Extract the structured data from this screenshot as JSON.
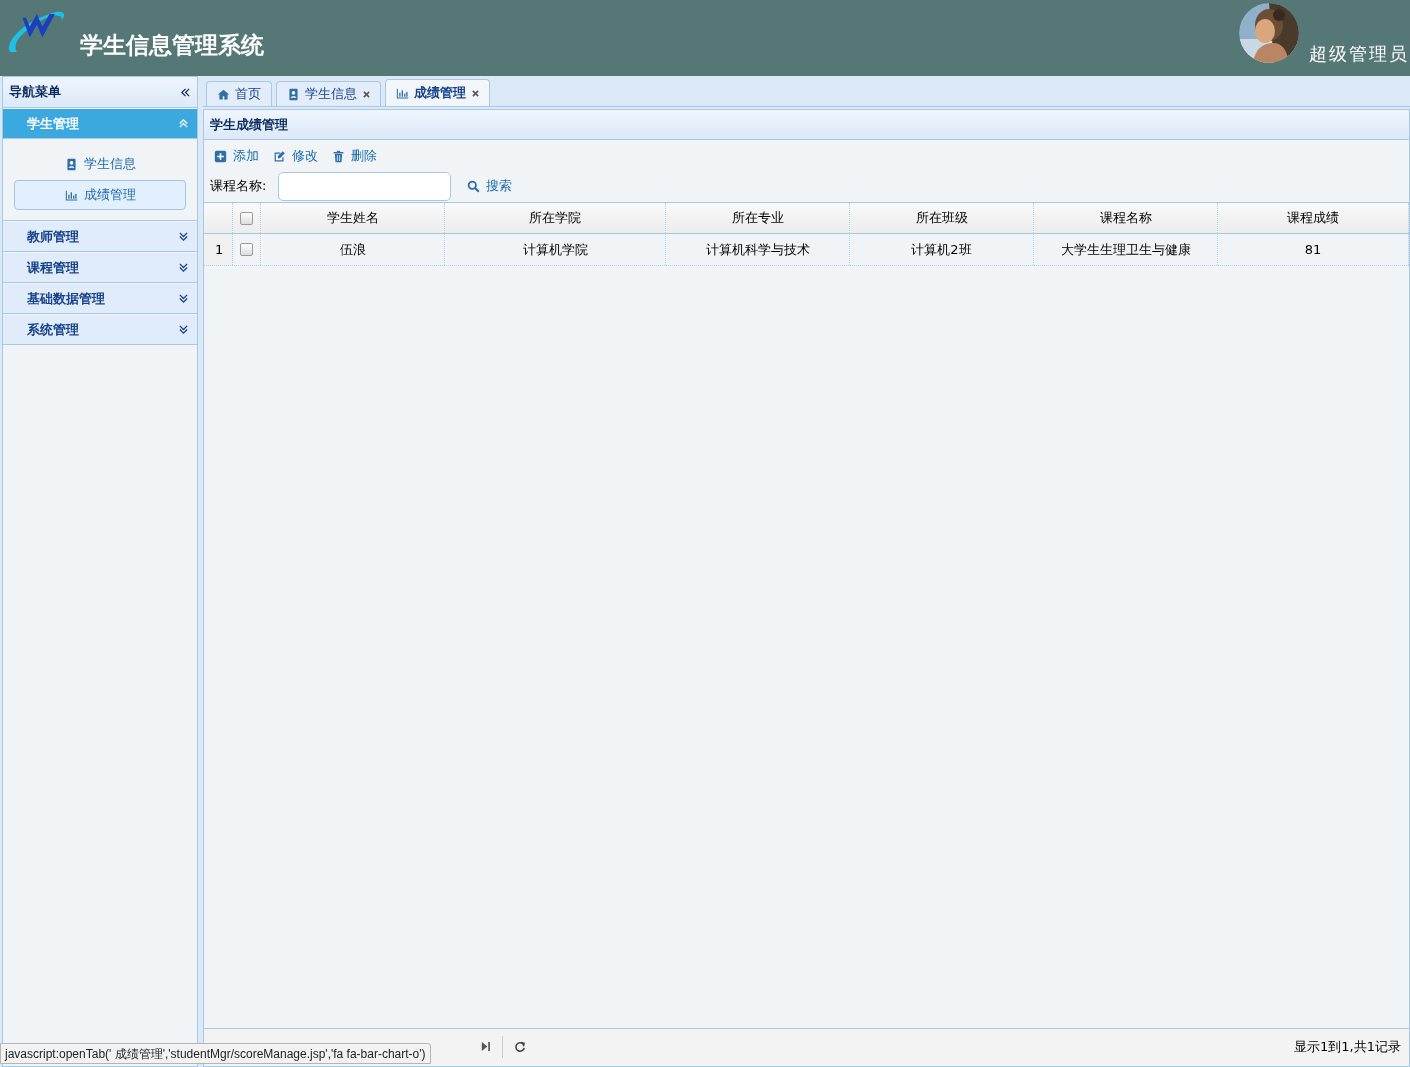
{
  "header": {
    "title": "学生信息管理系统",
    "user": "超级管理员"
  },
  "sidebar": {
    "title": "导航菜单",
    "groups": [
      {
        "label": "学生管理",
        "expanded": true,
        "items": [
          {
            "label": "学生信息",
            "kind": "contact",
            "selected": false
          },
          {
            "label": "成绩管理",
            "kind": "chart",
            "selected": true
          }
        ]
      },
      {
        "label": "教师管理",
        "expanded": false
      },
      {
        "label": "课程管理",
        "expanded": false
      },
      {
        "label": "基础数据管理",
        "expanded": false
      },
      {
        "label": "系统管理",
        "expanded": false
      }
    ]
  },
  "tabs": [
    {
      "label": "首页",
      "kind": "home",
      "closable": false,
      "selected": false
    },
    {
      "label": "学生信息",
      "kind": "contact",
      "closable": true,
      "selected": false
    },
    {
      "label": "成绩管理",
      "kind": "chart",
      "closable": true,
      "selected": true
    }
  ],
  "panel": {
    "title": "学生成绩管理",
    "toolbar": [
      {
        "label": "添加",
        "kind": "plus"
      },
      {
        "label": "修改",
        "kind": "edit"
      },
      {
        "label": "删除",
        "kind": "trash"
      }
    ],
    "search": {
      "label": "课程名称:",
      "button": "搜索"
    },
    "table": {
      "all_checked": false,
      "columns": [
        "学生姓名",
        "所在学院",
        "所在专业",
        "所在班级",
        "课程名称",
        "课程成绩"
      ],
      "rows": [
        {
          "number": "1",
          "checked": false,
          "cells": [
            "伍浪",
            "计算机学院",
            "计算机科学与技术",
            "计算机2班",
            "大学生生理卫生与健康",
            "81"
          ]
        }
      ]
    },
    "pager": {
      "info": "显示1到1,共1记录"
    }
  },
  "status_tooltip": "javascript:openTab(' 成绩管理','studentMgr/scoreManage.jsp','fa fa-bar-chart-o')"
}
